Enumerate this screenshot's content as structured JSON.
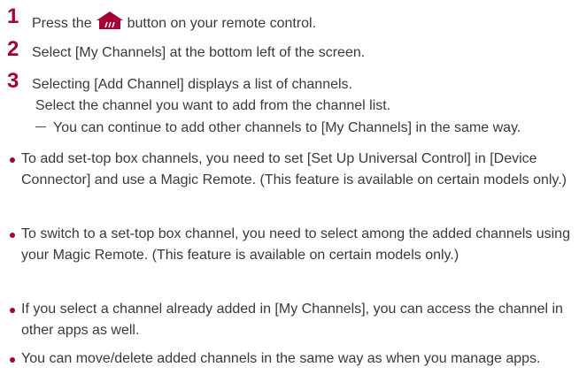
{
  "steps": [
    {
      "number": "1",
      "text_before": "Press the",
      "icon": "home-icon",
      "text_after": "button on your remote control."
    },
    {
      "number": "2",
      "text": "Select [My Channels] at the bottom left of the screen."
    },
    {
      "number": "3",
      "text": "Selecting [Add Channel] displays a list of channels.",
      "continuation": "Select the channel you want to add from the channel list.",
      "note": "You can continue to add other channels to [My Channels] in the same way."
    }
  ],
  "bullets": [
    "To add set-top box channels, you need to set [Set Up Universal Control] in [Device Connector] and use a Magic Remote. (This feature is available on certain models only.)",
    "To switch to a set-top box channel, you need to select among the added channels using your Magic Remote. (This feature is available on certain models only.)",
    "If you select a channel already added in [My Channels], you can access the channel in other apps as well.",
    "You can move/delete added channels in the same way as when you manage apps."
  ],
  "colors": {
    "accent": "#a50034",
    "text": "#3a3a3a"
  }
}
